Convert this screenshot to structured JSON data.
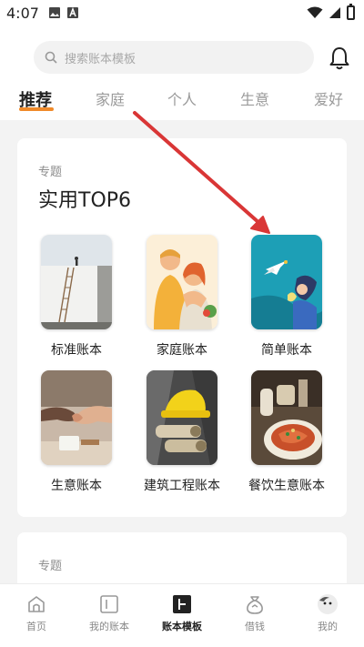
{
  "status_bar": {
    "time": "4:07"
  },
  "search": {
    "placeholder": "搜索账本模板"
  },
  "tabs": [
    "推荐",
    "家庭",
    "个人",
    "生意",
    "爱好"
  ],
  "section1": {
    "subtitle": "专题",
    "title": "实用TOP6",
    "items": [
      {
        "label": "标准账本"
      },
      {
        "label": "家庭账本"
      },
      {
        "label": "简单账本"
      },
      {
        "label": "生意账本"
      },
      {
        "label": "建筑工程账本"
      },
      {
        "label": "餐饮生意账本"
      }
    ]
  },
  "section2": {
    "subtitle": "专题"
  },
  "bottom_nav": [
    {
      "label": "首页"
    },
    {
      "label": "我的账本"
    },
    {
      "label": "账本模板"
    },
    {
      "label": "借钱"
    },
    {
      "label": "我的"
    }
  ],
  "colors": {
    "accent": "#f08a2a",
    "arrow": "#d93636"
  }
}
